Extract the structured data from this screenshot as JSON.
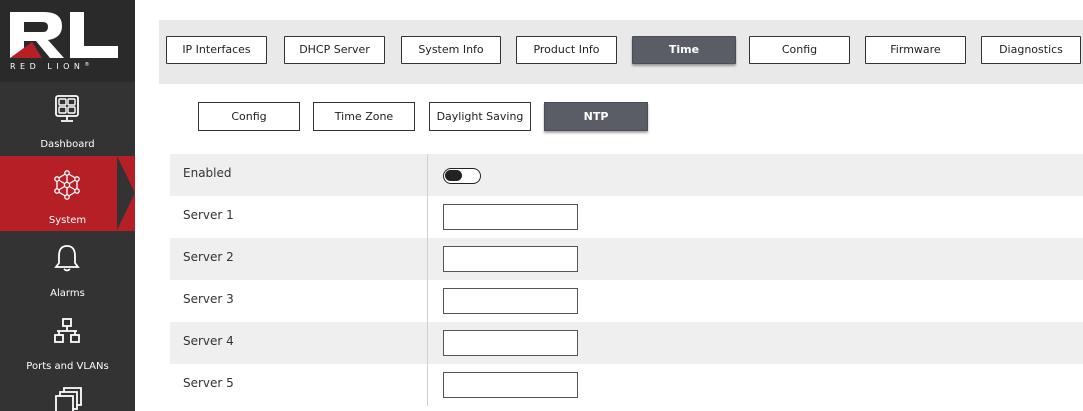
{
  "brand": {
    "logo_text": "RED LION",
    "trademark": "®",
    "red": "#b71f27",
    "sidebar_bg": "#333333"
  },
  "sidebar": {
    "items": [
      {
        "label": "Dashboard",
        "icon": "dashboard-icon",
        "active": false
      },
      {
        "label": "System",
        "icon": "system-network-icon",
        "active": true
      },
      {
        "label": "Alarms",
        "icon": "bell-icon",
        "active": false
      },
      {
        "label": "Ports and VLANs",
        "icon": "network-ports-icon",
        "active": false
      },
      {
        "label": "",
        "icon": "stacked-windows-icon",
        "active": false
      }
    ]
  },
  "tabs": [
    {
      "label": "IP Interfaces",
      "active": false
    },
    {
      "label": "DHCP Server",
      "active": false
    },
    {
      "label": "System Info",
      "active": false
    },
    {
      "label": "Product Info",
      "active": false
    },
    {
      "label": "Time",
      "active": true
    },
    {
      "label": "Config",
      "active": false
    },
    {
      "label": "Firmware",
      "active": false
    },
    {
      "label": "Diagnostics",
      "active": false
    }
  ],
  "subtabs": [
    {
      "label": "Config",
      "active": false
    },
    {
      "label": "Time Zone",
      "active": false
    },
    {
      "label": "Daylight Saving",
      "active": false
    },
    {
      "label": "NTP",
      "active": true
    }
  ],
  "form": {
    "enabled_label": "Enabled",
    "enabled": false,
    "servers": [
      {
        "label": "Server 1",
        "value": ""
      },
      {
        "label": "Server 2",
        "value": ""
      },
      {
        "label": "Server 3",
        "value": ""
      },
      {
        "label": "Server 4",
        "value": ""
      },
      {
        "label": "Server 5",
        "value": ""
      }
    ]
  }
}
